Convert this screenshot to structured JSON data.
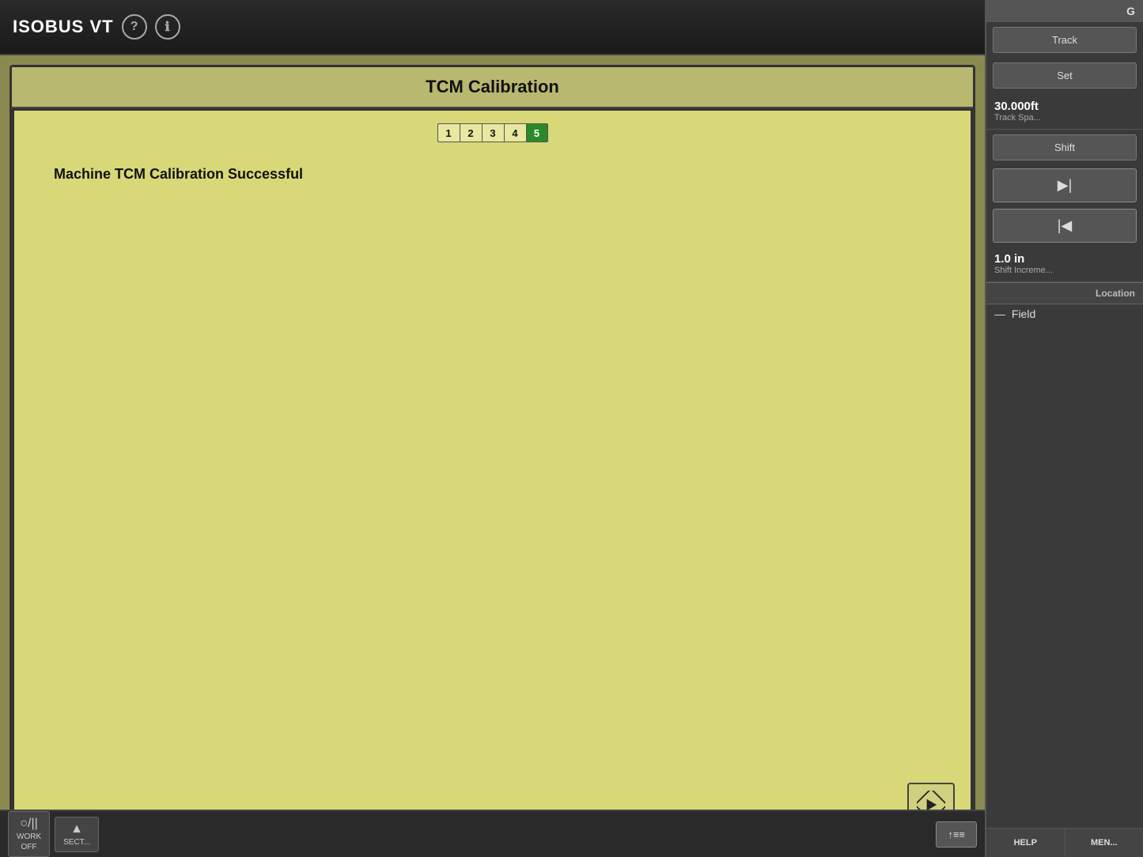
{
  "topbar": {
    "title": "ISOBUS VT",
    "help_icon": "?",
    "info_icon": "ℹ"
  },
  "close_button": {
    "label": "✕"
  },
  "dialog": {
    "title": "TCM Calibration",
    "steps": [
      {
        "number": "1",
        "active": false
      },
      {
        "number": "2",
        "active": false
      },
      {
        "number": "3",
        "active": false
      },
      {
        "number": "4",
        "active": false
      },
      {
        "number": "5",
        "active": true
      }
    ],
    "message": "Machine TCM Calibration   Successful",
    "next_button_label": "▶"
  },
  "right_panel": {
    "header": "G",
    "track_label": "Track",
    "set_label": "Set",
    "track_spacing_value": "30.000ft",
    "track_spacing_sublabel": "Track Spa...",
    "shift_label": "Shift",
    "shift_increment_value": "1.0 in",
    "shift_increment_sublabel": "Shift Increme...",
    "location_label": "Location",
    "field_label": "Field",
    "field_value": "—",
    "nav_forward": "▶|",
    "nav_back": "|◀",
    "help_label": "HELP",
    "menu_label": "MEN..."
  },
  "bottom_bar": {
    "work_btn_icon": "○/||",
    "work_btn_label": "WORK",
    "work_btn_sublabel": "OFF",
    "section_btn_icon": "▲",
    "section_btn_label": "SECT...",
    "menu_btn_label": "↑≡≡"
  }
}
